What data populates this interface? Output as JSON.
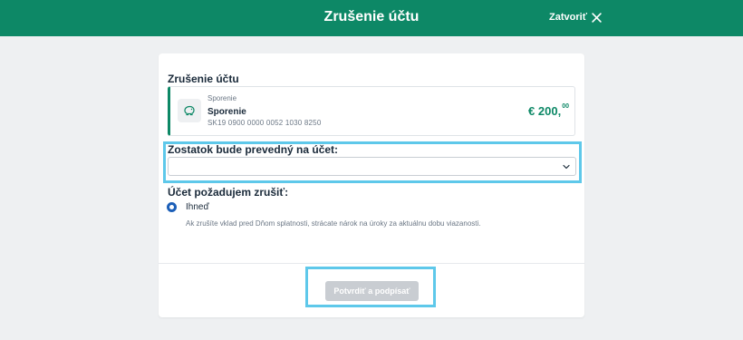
{
  "header": {
    "title": "Zrušenie účtu",
    "close_label": "Zatvoriť",
    "background": "#0d8866"
  },
  "card": {
    "section_title": "Zrušenie účtu",
    "account": {
      "type": "Sporenie",
      "name": "Sporenie",
      "iban": "SK19 0900 0000 0052 1030 8250",
      "amount_main": "€ 200,",
      "amount_cents": "00",
      "icon": "piggy-bank-icon"
    },
    "transfer": {
      "label": "Zostatok bude prevedný na účet:",
      "selected_value": ""
    },
    "cancel": {
      "label": "Účet požadujem zrušiť:",
      "option_label": "Ihneď",
      "note": "Ak zrušíte vklad pred Dňom splatnosti, strácate nárok na úroky za aktuálnu dobu viazanosti."
    },
    "confirm_label": "Potvrdiť a podpísať"
  },
  "colors": {
    "accent": "#0d8866",
    "radio": "#1c5fb8",
    "highlight": "#5ec8ea",
    "button_disabled": "#c9cdd2"
  }
}
